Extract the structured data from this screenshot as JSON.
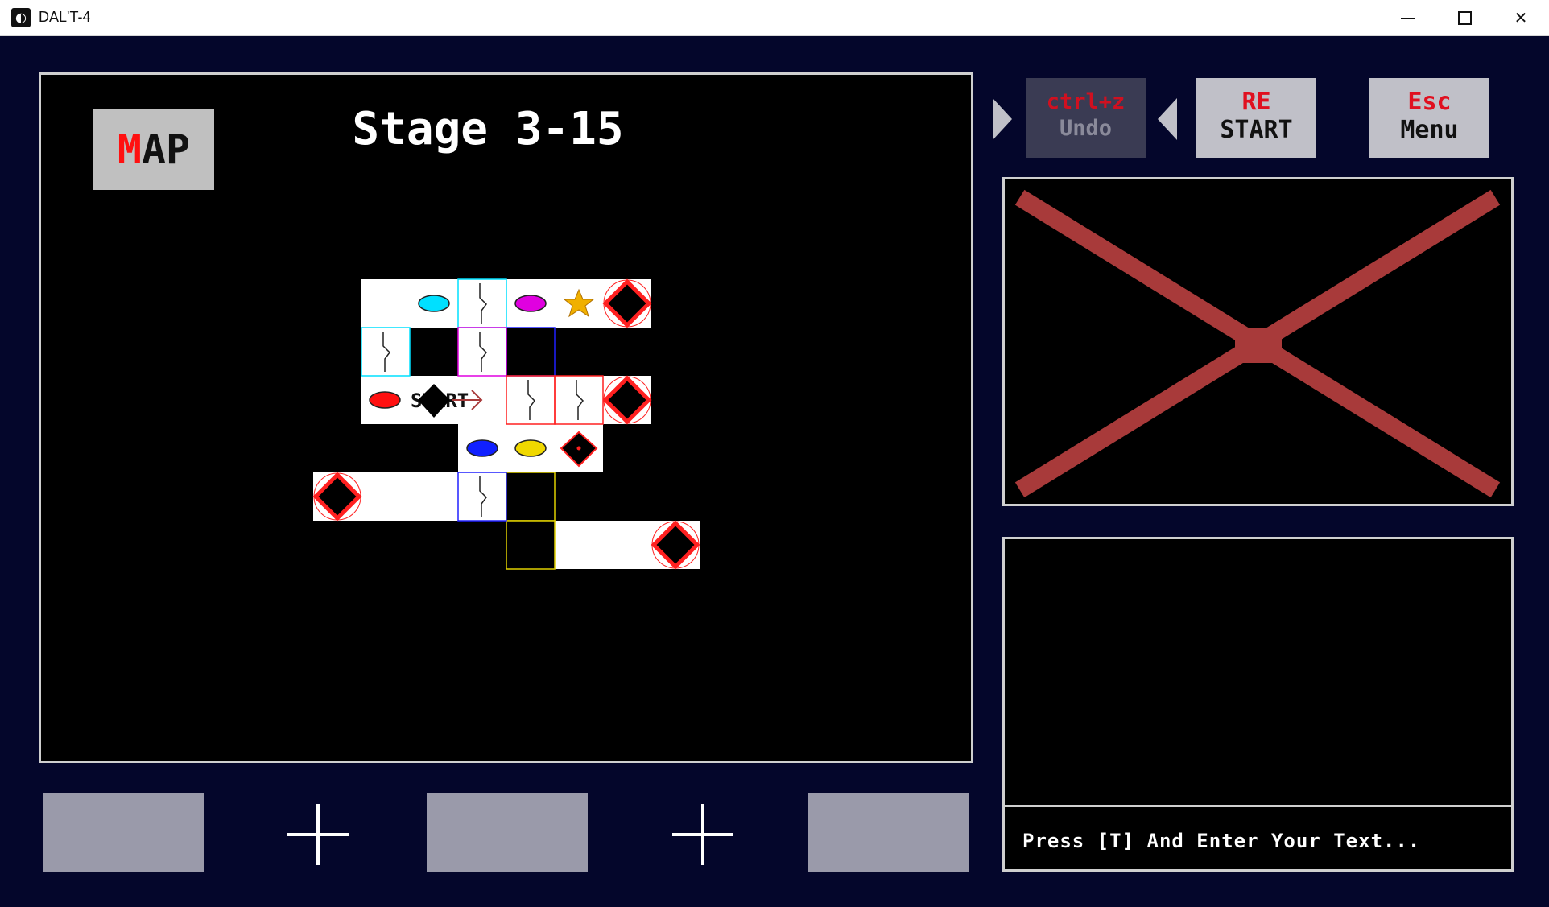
{
  "window": {
    "title": "DAL'T-4",
    "icon": "app-icon",
    "controls": [
      "minimize-icon",
      "maximize-icon",
      "close-icon"
    ],
    "close_glyph": "✕"
  },
  "hud": {
    "map_button": {
      "first": "M",
      "rest": "AP"
    },
    "stage_title": "Stage 3-15",
    "undo": {
      "key": "ctrl+z",
      "label": "Undo",
      "enabled": false
    },
    "restart": {
      "key": "RE",
      "label": "START"
    },
    "menu": {
      "key": "Esc",
      "label": "Menu"
    }
  },
  "preview": {
    "state": "empty",
    "icon": "red-x-icon"
  },
  "text_box": {
    "prompt": "Press [T] And Enter Your Text..."
  },
  "bottom_bar": {
    "slots": [
      "empty",
      "empty",
      "empty"
    ],
    "separators": [
      "plus-icon",
      "plus-icon"
    ]
  },
  "map": {
    "start_label": "START",
    "colors": {
      "tile": "#ffffff",
      "gate_cyan": "#00e0ff",
      "gate_magenta": "#e000e0",
      "gate_red": "#ff2020",
      "gate_blue": "#2020ff",
      "gate_yellow": "#e0d000",
      "star": "#f0b000",
      "goal_ring": "#ff2020"
    },
    "items": [
      "cyan-key",
      "magenta-key",
      "red-key",
      "blue-key",
      "yellow-key",
      "star",
      "goal x4",
      "small-goal",
      "player"
    ]
  },
  "colors": {
    "background": "#04062b",
    "panel_border": "#cfcfcf",
    "button_gray": "#c0c0c8",
    "undo_disabled": "#3a3b53",
    "slot_gray": "#9a9aaa",
    "key_red": "#e01020",
    "preview_x": "#a83a3a"
  }
}
